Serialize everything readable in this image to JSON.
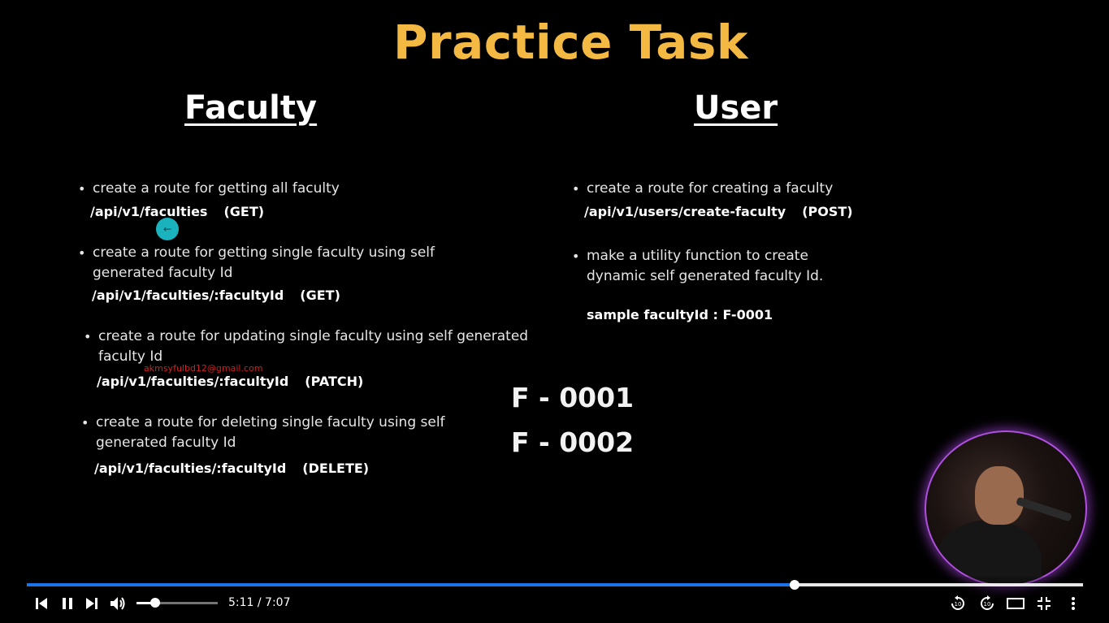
{
  "slide": {
    "title": "Practice Task",
    "faculty": {
      "heading": "Faculty",
      "items": [
        {
          "text": "create a route for getting all faculty",
          "route": "/api/v1/faculties",
          "method": "(GET)"
        },
        {
          "text": "create a route for getting single faculty using self",
          "text2": "generated faculty Id",
          "route": "/api/v1/faculties/:facultyId",
          "method": "(GET)"
        },
        {
          "text": "create a route for updating single faculty using self generated",
          "text2": "faculty Id",
          "route": "/api/v1/faculties/:facultyId",
          "method": "(PATCH)"
        },
        {
          "text": "create a route for deleting single faculty using self",
          "text2": "generated faculty Id",
          "route": "/api/v1/faculties/:facultyId",
          "method": "(DELETE)"
        }
      ]
    },
    "user": {
      "heading": "User",
      "items": [
        {
          "text": "create a route for creating a faculty",
          "route": "/api/v1/users/create-faculty",
          "method": "(POST)"
        },
        {
          "text": "make a utility function to create",
          "text2": "dynamic self generated faculty Id."
        }
      ],
      "sample": "sample facultyId : F-0001"
    },
    "ids": [
      "F - 0001",
      "F - 0002"
    ],
    "watermark": "akmsyfulbd12@gmail.com",
    "bullet_char": "•",
    "colors": {
      "title": "#f4b942",
      "progress": "#1a73e8",
      "webcam_ring": "#b14fe0"
    }
  },
  "player": {
    "time": "5:11 / 7:07",
    "progress": 0.727,
    "volume": 0.23,
    "buttons": {
      "previous": "previous-icon",
      "pause": "pause-icon",
      "next": "next-icon",
      "volume": "volume-icon",
      "rewind": "rewind-10-icon",
      "forward": "forward-10-icon",
      "theater": "theater-mode-icon",
      "exit_fullscreen": "exit-fullscreen-icon",
      "more": "more-vertical-icon"
    }
  }
}
